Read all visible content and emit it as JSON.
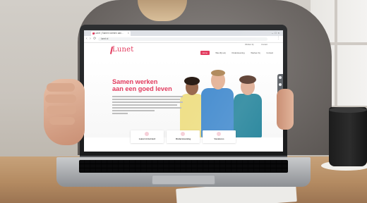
{
  "browser": {
    "tab_title": "Lunet | Samen werken aan...",
    "close_glyph": "×",
    "window_controls": "–□×",
    "nav_glyphs": "‹ › ⟳",
    "url": "lunet.nl",
    "menu_glyph": "⋮"
  },
  "site": {
    "logo": "Lunet",
    "topline": [
      "Werken bij",
      "Contact"
    ],
    "nav": [
      {
        "label": "Home",
        "active": true
      },
      {
        "label": "Wie Zijn wij",
        "active": false
      },
      {
        "label": "Ondersteuning",
        "active": false
      },
      {
        "label": "Werken bij",
        "active": false
      },
      {
        "label": "Contact",
        "active": false
      }
    ],
    "heading_line1": "Samen werken",
    "heading_line2": "aan een goed leven",
    "cards": [
      {
        "label": "Lunet in het kort",
        "icon": "heart-icon"
      },
      {
        "label": "Ondersteuning",
        "icon": "hands-icon"
      },
      {
        "label": "Vacatures",
        "icon": "briefcase-icon"
      }
    ]
  },
  "colors": {
    "brand": "#e23b5e",
    "laptop_bezel": "#1f2022",
    "sweater": "#6f6a67"
  }
}
